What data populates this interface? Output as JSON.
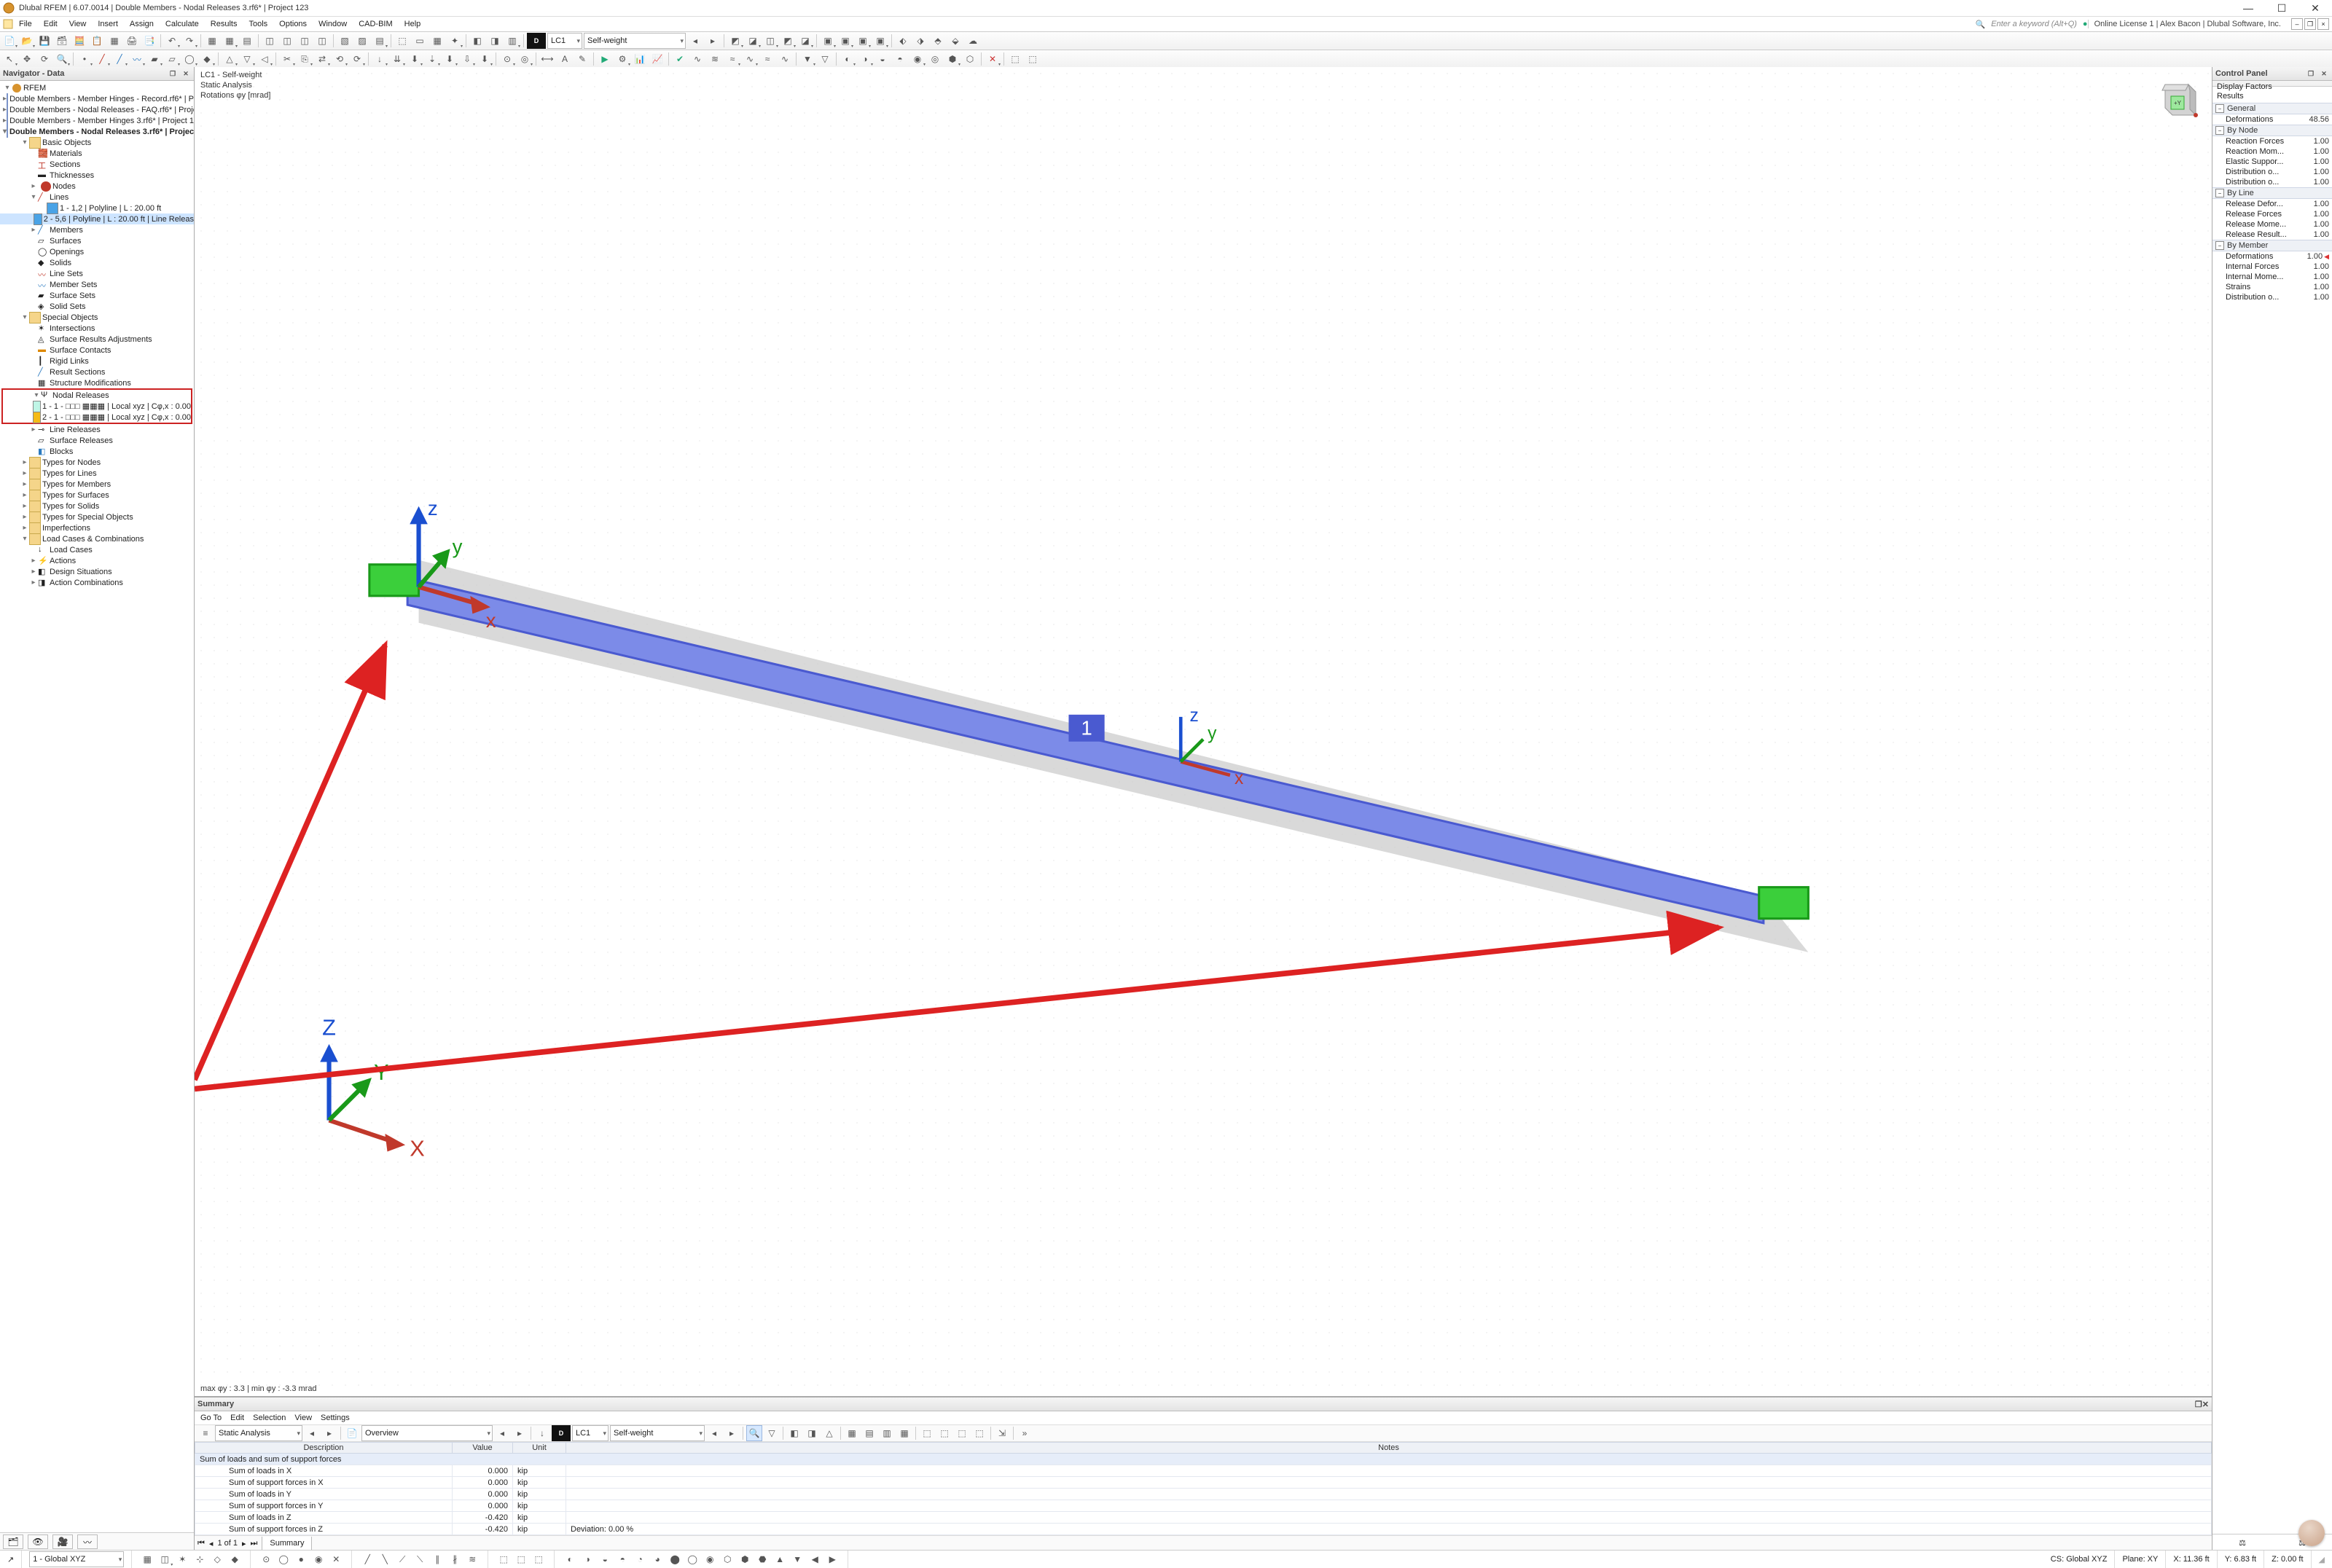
{
  "titlebar": {
    "text": "Dlubal RFEM | 6.07.0014 | Double Members - Nodal Releases 3.rf6* | Project 123"
  },
  "menu": {
    "items": [
      "File",
      "Edit",
      "View",
      "Insert",
      "Assign",
      "Calculate",
      "Results",
      "Tools",
      "Options",
      "Window",
      "CAD-BIM",
      "Help"
    ],
    "search_placeholder": "Enter a keyword (Alt+Q)",
    "license": "Online License 1 | Alex Bacon | Dlubal Software, Inc."
  },
  "toolbar1": {
    "lc_code": "D",
    "lc_num": "LC1",
    "lc_name": "Self-weight"
  },
  "navigator": {
    "title": "Navigator - Data",
    "root": "RFEM",
    "projects": [
      "Double Members - Member Hinges - Record.rf6* | P",
      "Double Members - Nodal Releases - FAQ.rf6* | Proje",
      "Double Members - Member Hinges 3.rf6* | Project 1",
      "Double Members - Nodal Releases 3.rf6* | Project 1"
    ],
    "basic_objects": "Basic Objects",
    "bo_items": [
      "Materials",
      "Sections",
      "Thicknesses",
      "Nodes",
      "Lines"
    ],
    "line1": "1 - 1,2 | Polyline | L : 20.00 ft",
    "line2": "2 - 5,6 | Polyline | L : 20.00 ft | Line Releas",
    "bo_rest": [
      "Members",
      "Surfaces",
      "Openings",
      "Solids",
      "Line Sets",
      "Member Sets",
      "Surface Sets",
      "Solid Sets"
    ],
    "special_objects": "Special Objects",
    "so_items": [
      "Intersections",
      "Surface Results Adjustments",
      "Surface Contacts",
      "Rigid Links",
      "Result Sections",
      "Structure Modifications"
    ],
    "nodal_releases": "Nodal Releases",
    "nr1": "1 - 1 - □□□ ▦▦▦ | Local xyz | Cφ,x : 0.00",
    "nr2": "2 - 1 - □□□ ▦▦▦ | Local xyz | Cφ,x : 0.00",
    "so_rest": [
      "Line Releases",
      "Surface Releases",
      "Blocks"
    ],
    "types": [
      "Types for Nodes",
      "Types for Lines",
      "Types for Members",
      "Types for Surfaces",
      "Types for Solids",
      "Types for Special Objects",
      "Imperfections"
    ],
    "lcc": "Load Cases & Combinations",
    "lcc_items": [
      "Load Cases",
      "Actions",
      "Design Situations",
      "Action Combinations"
    ]
  },
  "viewport": {
    "line1": "LC1 - Self-weight",
    "line2": "Static Analysis",
    "line3": "Rotations φy [mrad]",
    "footer": "max φy : 3.3 | min φy : -3.3 mrad",
    "label1": "1"
  },
  "control": {
    "title": "Control Panel",
    "head1": "Display Factors",
    "head2": "Results",
    "groups": [
      {
        "name": "General",
        "rows": [
          {
            "k": "Deformations",
            "v": "48.56"
          }
        ]
      },
      {
        "name": "By Node",
        "rows": [
          {
            "k": "Reaction Forces",
            "v": "1.00"
          },
          {
            "k": "Reaction Mom...",
            "v": "1.00"
          },
          {
            "k": "Elastic Suppor...",
            "v": "1.00"
          },
          {
            "k": "Distribution o...",
            "v": "1.00"
          },
          {
            "k": "Distribution o...",
            "v": "1.00"
          }
        ]
      },
      {
        "name": "By Line",
        "rows": [
          {
            "k": "Release Defor...",
            "v": "1.00"
          },
          {
            "k": "Release Forces",
            "v": "1.00"
          },
          {
            "k": "Release Mome...",
            "v": "1.00"
          },
          {
            "k": "Release Result...",
            "v": "1.00"
          }
        ]
      },
      {
        "name": "By Member",
        "rows": [
          {
            "k": "Deformations",
            "v": "1.00",
            "mark": true
          },
          {
            "k": "Internal Forces",
            "v": "1.00"
          },
          {
            "k": "Internal Mome...",
            "v": "1.00"
          },
          {
            "k": "Strains",
            "v": "1.00"
          },
          {
            "k": "Distribution o...",
            "v": "1.00"
          }
        ]
      }
    ]
  },
  "summary": {
    "title": "Summary",
    "menu": [
      "Go To",
      "Edit",
      "Selection",
      "View",
      "Settings"
    ],
    "analysis": "Static Analysis",
    "overview": "Overview",
    "lc_code": "D",
    "lc_num": "LC1",
    "lc_name": "Self-weight",
    "cols": [
      "Description",
      "Value",
      "Unit",
      "Notes"
    ],
    "section": "Sum of loads and sum of support forces",
    "rows": [
      {
        "d": "Sum of loads in X",
        "v": "0.000",
        "u": "kip",
        "n": ""
      },
      {
        "d": "Sum of support forces in X",
        "v": "0.000",
        "u": "kip",
        "n": ""
      },
      {
        "d": "Sum of loads in Y",
        "v": "0.000",
        "u": "kip",
        "n": ""
      },
      {
        "d": "Sum of support forces in Y",
        "v": "0.000",
        "u": "kip",
        "n": ""
      },
      {
        "d": "Sum of loads in Z",
        "v": "-0.420",
        "u": "kip",
        "n": ""
      },
      {
        "d": "Sum of support forces in Z",
        "v": "-0.420",
        "u": "kip",
        "n": "Deviation: 0.00 %"
      }
    ],
    "pager": "1 of 1",
    "tab": "Summary"
  },
  "bottombar": {
    "cs": "1 - Global XYZ"
  },
  "status": {
    "cs": "CS: Global XYZ",
    "plane": "Plane: XY",
    "x": "X: 11.36 ft",
    "y": "Y: 6.83 ft",
    "z": "Z: 0.00 ft"
  }
}
